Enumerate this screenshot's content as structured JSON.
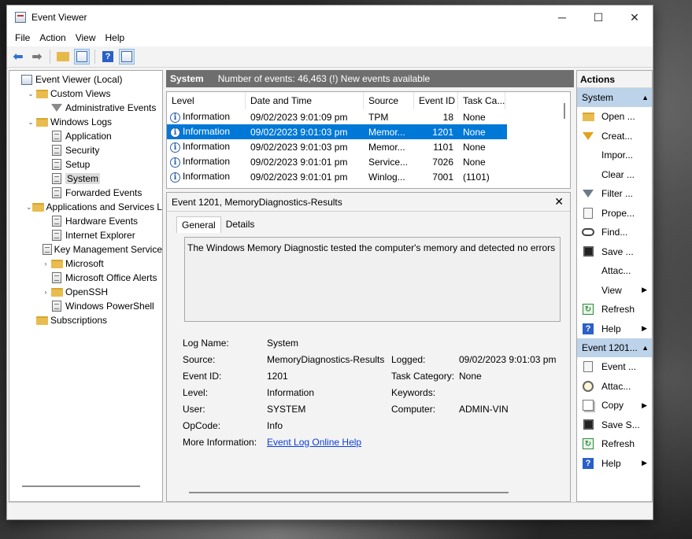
{
  "window": {
    "title": "Event Viewer",
    "controls": {
      "minimize": "─",
      "maximize": "☐",
      "close": "✕"
    }
  },
  "menu": [
    "File",
    "Action",
    "View",
    "Help"
  ],
  "tree": [
    {
      "label": "Event Viewer (Local)",
      "level": 0,
      "expander": "",
      "icon": "event-viewer-icon"
    },
    {
      "label": "Custom Views",
      "level": 1,
      "expander": "⌄",
      "icon": "folder-icon"
    },
    {
      "label": "Administrative Events",
      "level": 2,
      "expander": "",
      "icon": "filter-icon"
    },
    {
      "label": "Windows Logs",
      "level": 1,
      "expander": "⌄",
      "icon": "folder-icon"
    },
    {
      "label": "Application",
      "level": 2,
      "expander": "",
      "icon": "log-icon"
    },
    {
      "label": "Security",
      "level": 2,
      "expander": "",
      "icon": "log-icon"
    },
    {
      "label": "Setup",
      "level": 2,
      "expander": "",
      "icon": "log-icon"
    },
    {
      "label": "System",
      "level": 2,
      "expander": "",
      "icon": "log-icon",
      "selected": true
    },
    {
      "label": "Forwarded Events",
      "level": 2,
      "expander": "",
      "icon": "log-icon"
    },
    {
      "label": "Applications and Services Lo",
      "level": 1,
      "expander": "⌄",
      "icon": "folder-icon"
    },
    {
      "label": "Hardware Events",
      "level": 2,
      "expander": "",
      "icon": "log-icon"
    },
    {
      "label": "Internet Explorer",
      "level": 2,
      "expander": "",
      "icon": "log-icon"
    },
    {
      "label": "Key Management Service",
      "level": 2,
      "expander": "",
      "icon": "log-icon"
    },
    {
      "label": "Microsoft",
      "level": 2,
      "expander": "›",
      "icon": "folder-icon"
    },
    {
      "label": "Microsoft Office Alerts",
      "level": 2,
      "expander": "",
      "icon": "log-icon"
    },
    {
      "label": "OpenSSH",
      "level": 2,
      "expander": "›",
      "icon": "folder-icon"
    },
    {
      "label": "Windows PowerShell",
      "level": 2,
      "expander": "",
      "icon": "log-icon"
    },
    {
      "label": "Subscriptions",
      "level": 1,
      "expander": "",
      "icon": "folder-icon"
    }
  ],
  "middle": {
    "log_name": "System",
    "event_count": "Number of events: 46,463 (!) New events available",
    "columns": [
      "Level",
      "Date and Time",
      "Source",
      "Event ID",
      "Task Ca..."
    ],
    "rows": [
      {
        "level": "Information",
        "date": "09/02/2023 9:01:09 pm",
        "source": "TPM",
        "id": "18",
        "task": "None"
      },
      {
        "level": "Information",
        "date": "09/02/2023 9:01:03 pm",
        "source": "Memor...",
        "id": "1201",
        "task": "None",
        "selected": true
      },
      {
        "level": "Information",
        "date": "09/02/2023 9:01:03 pm",
        "source": "Memor...",
        "id": "1101",
        "task": "None"
      },
      {
        "level": "Information",
        "date": "09/02/2023 9:01:01 pm",
        "source": "Service...",
        "id": "7026",
        "task": "None"
      },
      {
        "level": "Information",
        "date": "09/02/2023 9:01:01 pm",
        "source": "Winlog...",
        "id": "7001",
        "task": "(1101)"
      }
    ]
  },
  "detail": {
    "title": "Event 1201, MemoryDiagnostics-Results",
    "close": "✕",
    "tabs": [
      "General",
      "Details"
    ],
    "description": "The Windows Memory Diagnostic tested the computer's memory and detected no errors",
    "labels": {
      "log_name": "Log Name:",
      "source": "Source:",
      "event_id": "Event ID:",
      "level": "Level:",
      "user": "User:",
      "opcode": "OpCode:",
      "more_info": "More Information:",
      "logged": "Logged:",
      "task_category": "Task Category:",
      "keywords": "Keywords:",
      "computer": "Computer:"
    },
    "values": {
      "log_name": "System",
      "source": "MemoryDiagnostics-Results",
      "event_id": "1201",
      "level": "Information",
      "user": "SYSTEM",
      "opcode": "Info",
      "more_info_link": "Event Log Online Help",
      "logged": "09/02/2023 9:01:03 pm",
      "task_category": "None",
      "keywords": "",
      "computer": "ADMIN-VIN"
    }
  },
  "actions": {
    "title": "Actions",
    "section1": "System",
    "items1": [
      {
        "label": "Open ...",
        "icon": "folder-icon"
      },
      {
        "label": "Creat...",
        "icon": "filter-create-icon"
      },
      {
        "label": "Impor...",
        "icon": "blank-icon"
      },
      {
        "label": "Clear ...",
        "icon": "blank-icon"
      },
      {
        "label": "Filter ...",
        "icon": "filter-icon"
      },
      {
        "label": "Prope...",
        "icon": "properties-icon"
      },
      {
        "label": "Find...",
        "icon": "binoculars-icon"
      },
      {
        "label": "Save ...",
        "icon": "save-icon"
      },
      {
        "label": "Attac...",
        "icon": "blank-icon"
      },
      {
        "label": "View",
        "icon": "blank-icon",
        "submenu": true
      },
      {
        "label": "Refresh",
        "icon": "refresh-icon"
      },
      {
        "label": "Help",
        "icon": "help-icon",
        "submenu": true
      }
    ],
    "section2": "Event 1201...",
    "items2": [
      {
        "label": "Event ...",
        "icon": "event-properties-icon"
      },
      {
        "label": "Attac...",
        "icon": "attach-task-icon"
      },
      {
        "label": "Copy",
        "icon": "copy-icon",
        "submenu": true
      },
      {
        "label": "Save S...",
        "icon": "save-icon"
      },
      {
        "label": "Refresh",
        "icon": "refresh-icon"
      },
      {
        "label": "Help",
        "icon": "help-icon",
        "submenu": true
      }
    ]
  }
}
